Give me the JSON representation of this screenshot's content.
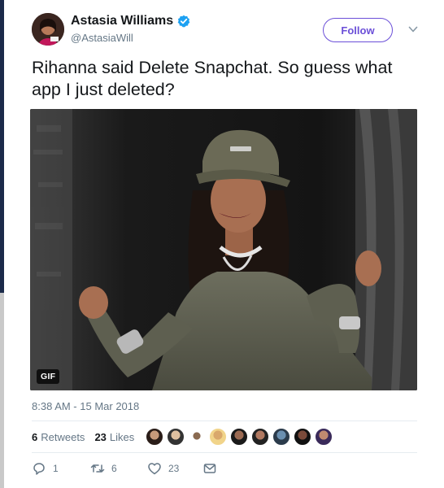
{
  "author": {
    "name": "Astasia Williams",
    "handle": "@AstasiaWill",
    "verified": true
  },
  "follow_button": {
    "label": "Follow"
  },
  "tweet": {
    "text": "Rihanna said Delete Snapchat. So guess what app I just deleted?",
    "media_badge": "GIF",
    "timestamp": "8:38 AM - 15 Mar 2018"
  },
  "stats": {
    "retweets_count": "6",
    "retweets_label": "Retweets",
    "likes_count": "23",
    "likes_label": "Likes"
  },
  "actions": {
    "reply_count": "1",
    "retweet_count": "6",
    "like_count": "23"
  },
  "colors": {
    "accent": "#6b4fd8",
    "verified": "#1da1f2",
    "muted": "#657786"
  },
  "icons": [
    "verified-badge-icon",
    "chevron-down-icon",
    "reply-icon",
    "retweet-icon",
    "like-icon",
    "direct-message-icon"
  ]
}
